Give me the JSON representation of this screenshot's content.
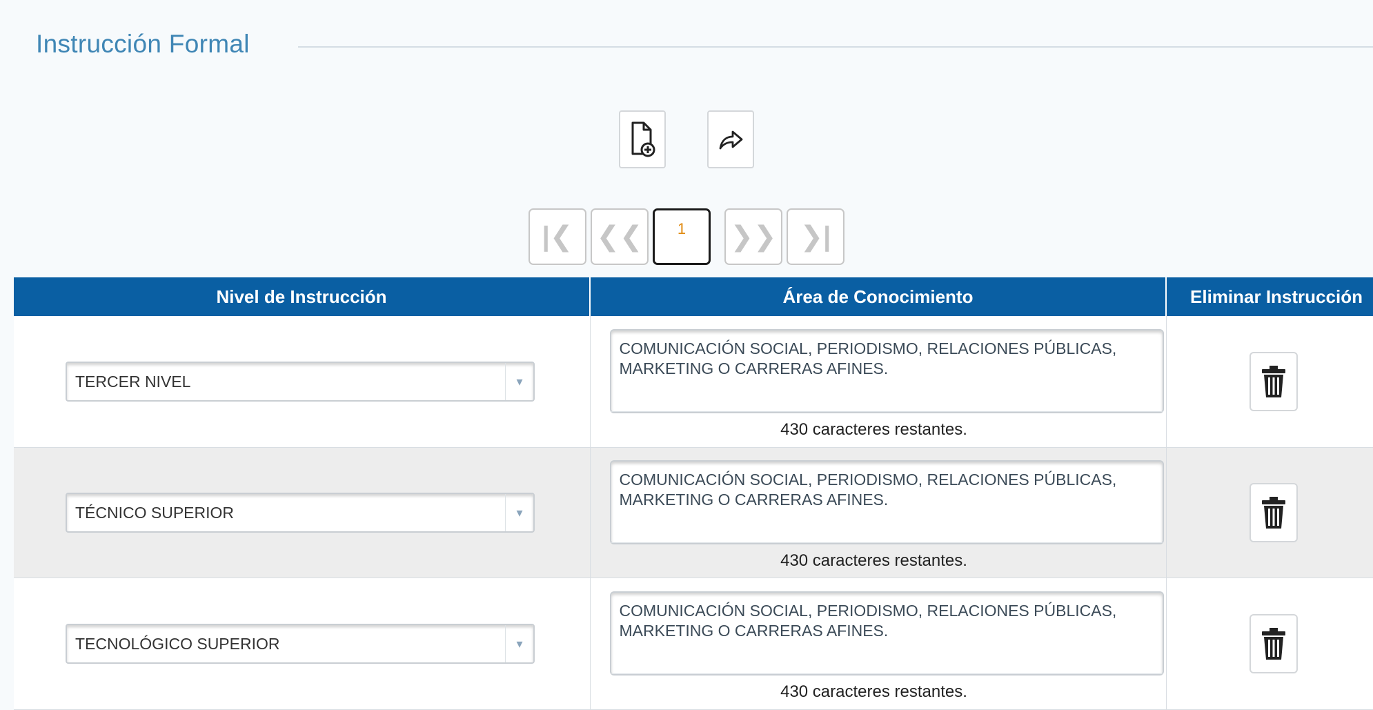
{
  "section": {
    "title": "Instrucción Formal"
  },
  "toolbar": {
    "new_icon": "new-document-icon",
    "share_icon": "share-arrow-icon"
  },
  "pager": {
    "first": "first-page-icon",
    "prev": "previous-page-icon",
    "current_page": "1",
    "next": "next-page-icon",
    "last": "last-page-icon"
  },
  "table": {
    "headers": [
      "Nivel de Instrucción",
      "Área de Conocimiento",
      "Eliminar Instrucción"
    ],
    "rows": [
      {
        "nivel": "TERCER NIVEL",
        "area": "COMUNICACIÓN SOCIAL, PERIODISMO, RELACIONES PÚBLICAS, MARKETING O CARRERAS AFINES.",
        "counter": "430 caracteres restantes."
      },
      {
        "nivel": "TÉCNICO SUPERIOR",
        "area": "COMUNICACIÓN SOCIAL, PERIODISMO, RELACIONES PÚBLICAS, MARKETING O CARRERAS AFINES.",
        "counter": "430 caracteres restantes."
      },
      {
        "nivel": "TECNOLÓGICO SUPERIOR",
        "area": "COMUNICACIÓN SOCIAL, PERIODISMO, RELACIONES PÚBLICAS, MARKETING O CARRERAS AFINES.",
        "counter": "430 caracteres restantes."
      }
    ]
  },
  "colors": {
    "header_bg": "#0a5fa3",
    "title": "#3f86b5",
    "current_page": "#e08a10"
  }
}
